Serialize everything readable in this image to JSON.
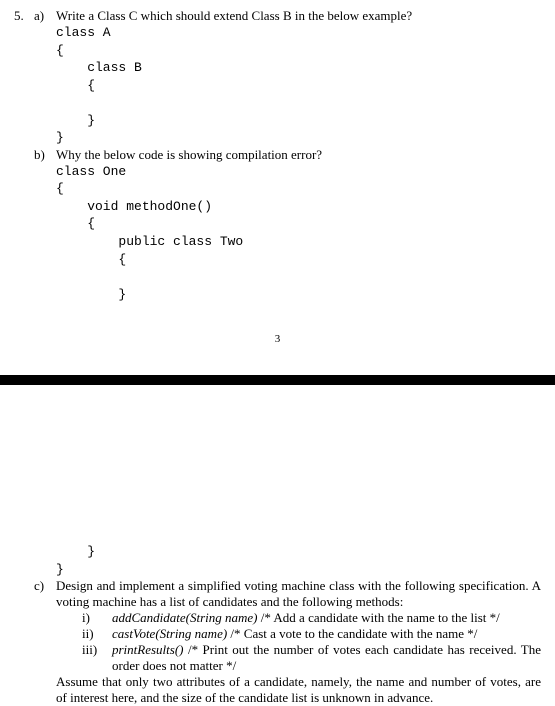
{
  "q5": {
    "number": "5.",
    "parts": {
      "a": {
        "letter": "a)",
        "text": "Write a Class C which should extend Class B in the below example?",
        "code": "class A\n{\n    class B\n    {\n\n    }\n}"
      },
      "b": {
        "letter": "b)",
        "text": "Why the below code is showing compilation error?",
        "code_top": "class One\n{\n    void methodOne()\n    {\n        public class Two\n        {\n\n        }",
        "code_bottom": "    }\n}"
      },
      "c": {
        "letter": "c)",
        "text": "Design and implement a simplified voting machine class with the following specification. A voting machine has a list of candidates and the following methods:",
        "items": {
          "i": {
            "marker": "i)",
            "method": "addCandidate(String name)",
            "comment": " /* Add a candidate with the name to the list */"
          },
          "ii": {
            "marker": "ii)",
            "method": "castVote(String name)",
            "comment": " /* Cast a vote to the candidate with the name */"
          },
          "iii": {
            "marker": "iii)",
            "method": "printResults()",
            "comment": " /* Print out the number of votes each candidate has received. The order does not matter */"
          }
        },
        "assume": "Assume that only two attributes of a candidate, namely, the name and number of votes, are of interest here, and the size of the candidate list is unknown in advance."
      }
    }
  },
  "page_number": "3"
}
